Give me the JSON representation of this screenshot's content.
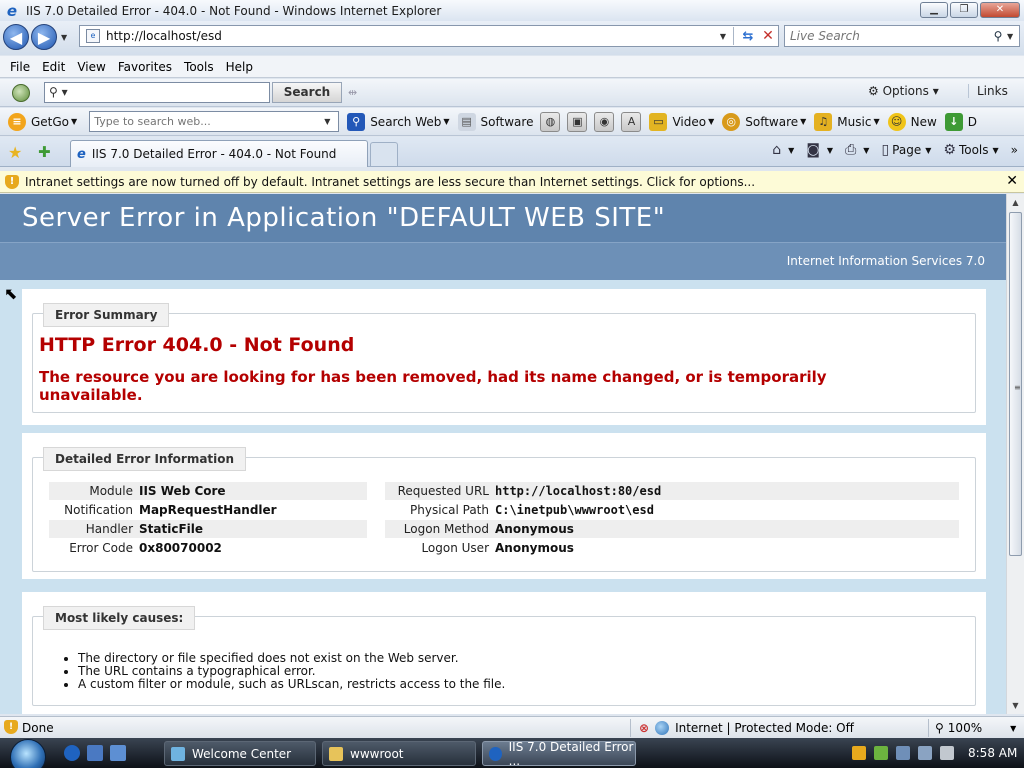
{
  "window": {
    "title": "IIS 7.0 Detailed Error - 404.0 - Not Found - Windows Internet Explorer",
    "controls": {
      "minimize": "▁",
      "maximize": "❐",
      "close": "✕"
    }
  },
  "address_bar": {
    "url": "http://localhost/esd",
    "live_search_placeholder": "Live Search"
  },
  "menu": [
    "File",
    "Edit",
    "View",
    "Favorites",
    "Tools",
    "Help"
  ],
  "search_toolbar": {
    "button": "Search",
    "options": "Options",
    "links": "Links"
  },
  "getgo_toolbar": {
    "getgo": "GetGo",
    "web_placeholder": "Type to search web...",
    "search_web": "Search Web",
    "software1": "Software",
    "video": "Video",
    "software2": "Software",
    "music": "Music",
    "new": "New",
    "trailing": "D"
  },
  "tabs": {
    "active_tab": "IIS 7.0 Detailed Error - 404.0 - Not Found",
    "page": "Page",
    "tools": "Tools"
  },
  "info_bar": {
    "message": "Intranet settings are now turned off by default. Intranet settings are less secure than Internet settings. Click for options..."
  },
  "page": {
    "header_title": "Server Error in Application \"DEFAULT WEB SITE\"",
    "header_subtitle": "Internet Information Services 7.0",
    "error_summary": {
      "legend": "Error Summary",
      "title": "HTTP Error 404.0 - Not Found",
      "description": "The resource you are looking for has been removed, had its name changed, or is temporarily unavailable."
    },
    "detailed": {
      "legend": "Detailed Error Information",
      "left": [
        {
          "label": "Module",
          "value": "IIS Web Core"
        },
        {
          "label": "Notification",
          "value": "MapRequestHandler"
        },
        {
          "label": "Handler",
          "value": "StaticFile"
        },
        {
          "label": "Error Code",
          "value": "0x80070002"
        }
      ],
      "right": [
        {
          "label": "Requested URL",
          "value": "http://localhost:80/esd"
        },
        {
          "label": "Physical Path",
          "value": "C:\\inetpub\\wwwroot\\esd"
        },
        {
          "label": "Logon Method",
          "value": "Anonymous"
        },
        {
          "label": "Logon User",
          "value": "Anonymous"
        }
      ]
    },
    "causes": {
      "legend": "Most likely causes:",
      "items": [
        "The directory or file specified does not exist on the Web server.",
        "The URL contains a typographical error.",
        "A custom filter or module, such as URLscan, restricts access to the file."
      ]
    }
  },
  "status_bar": {
    "status": "Done",
    "zone": "Internet | Protected Mode: Off",
    "zoom": "100%"
  },
  "taskbar": {
    "tasks": [
      "Welcome Center",
      "wwwroot",
      "IIS 7.0 Detailed Error ..."
    ],
    "clock": "8:58 AM"
  },
  "colors": {
    "header_bg": "#5f84ad",
    "error_red": "#b40000",
    "content_bg": "#cbe1ef"
  }
}
